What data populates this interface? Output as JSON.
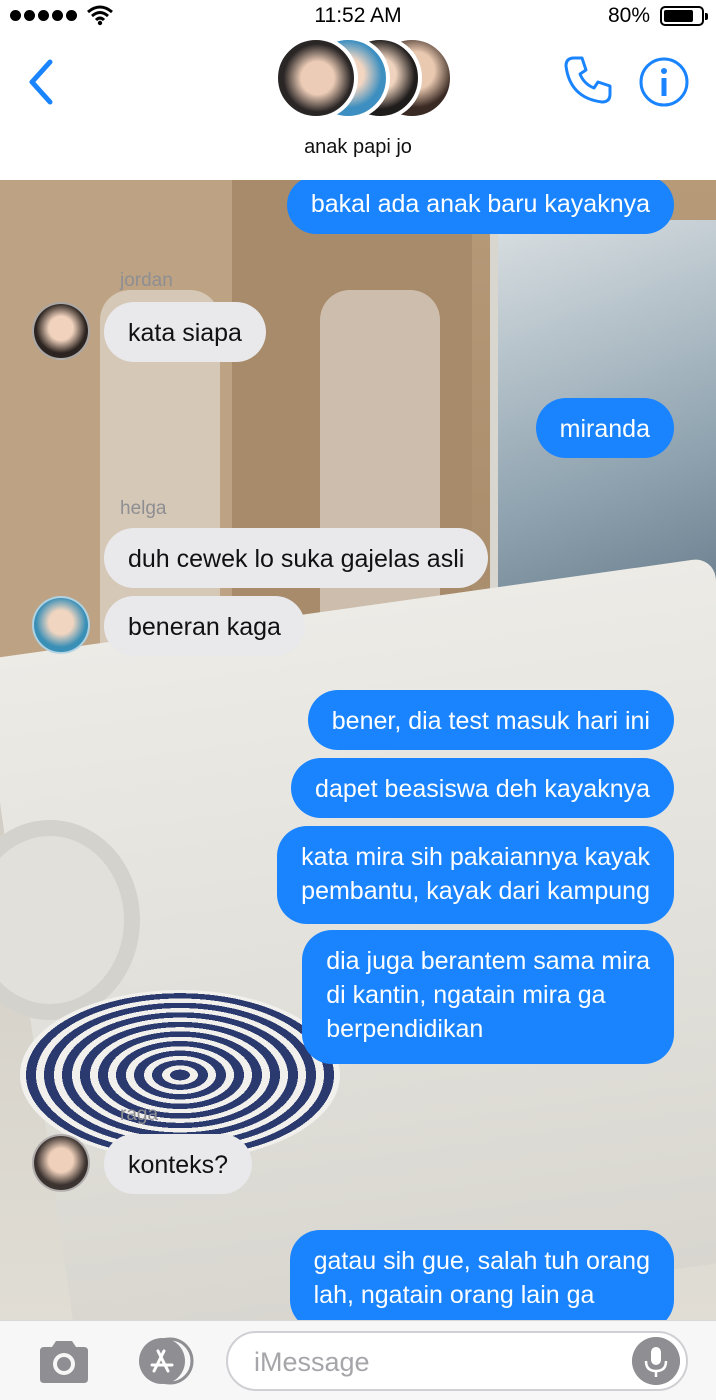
{
  "status_bar": {
    "time": "11:52 AM",
    "battery_percent": "80%",
    "battery_level": 0.8,
    "signal_dots": 5
  },
  "header": {
    "title": "anak papi jo",
    "icons": {
      "back": "chevron-left-icon",
      "call": "phone-icon",
      "info": "info-icon"
    }
  },
  "messages": [
    {
      "direction": "out",
      "text": "bakal ada anak baru kayaknya"
    },
    {
      "direction": "in",
      "sender": "jordan",
      "text": "kata siapa"
    },
    {
      "direction": "out",
      "text": "miranda"
    },
    {
      "direction": "in",
      "sender": "helga",
      "text": "duh cewek lo suka gajelas asli"
    },
    {
      "direction": "in",
      "text": "beneran kaga"
    },
    {
      "direction": "out",
      "text": "bener, dia test masuk hari ini"
    },
    {
      "direction": "out",
      "text": "dapet beasiswa deh kayaknya"
    },
    {
      "direction": "out",
      "lines": [
        "kata mira sih pakaiannya kayak",
        "pembantu, kayak dari kampung"
      ]
    },
    {
      "direction": "out",
      "lines": [
        "dia juga berantem sama mira",
        "di kantin, ngatain mira ga",
        "berpendidikan"
      ]
    },
    {
      "direction": "in",
      "sender": "raga",
      "text": "konteks?"
    },
    {
      "direction": "out",
      "lines": [
        "gatau sih gue, salah tuh orang",
        "lah, ngatain orang lain ga"
      ]
    }
  ],
  "input_bar": {
    "placeholder": "iMessage",
    "icons": {
      "camera": "camera-icon",
      "apps": "app-store-icon",
      "mic": "microphone-icon"
    }
  },
  "colors": {
    "accent": "#1a84ff",
    "outgoing_bubble": "#1a84ff",
    "incoming_bubble": "#e9e9ec"
  }
}
